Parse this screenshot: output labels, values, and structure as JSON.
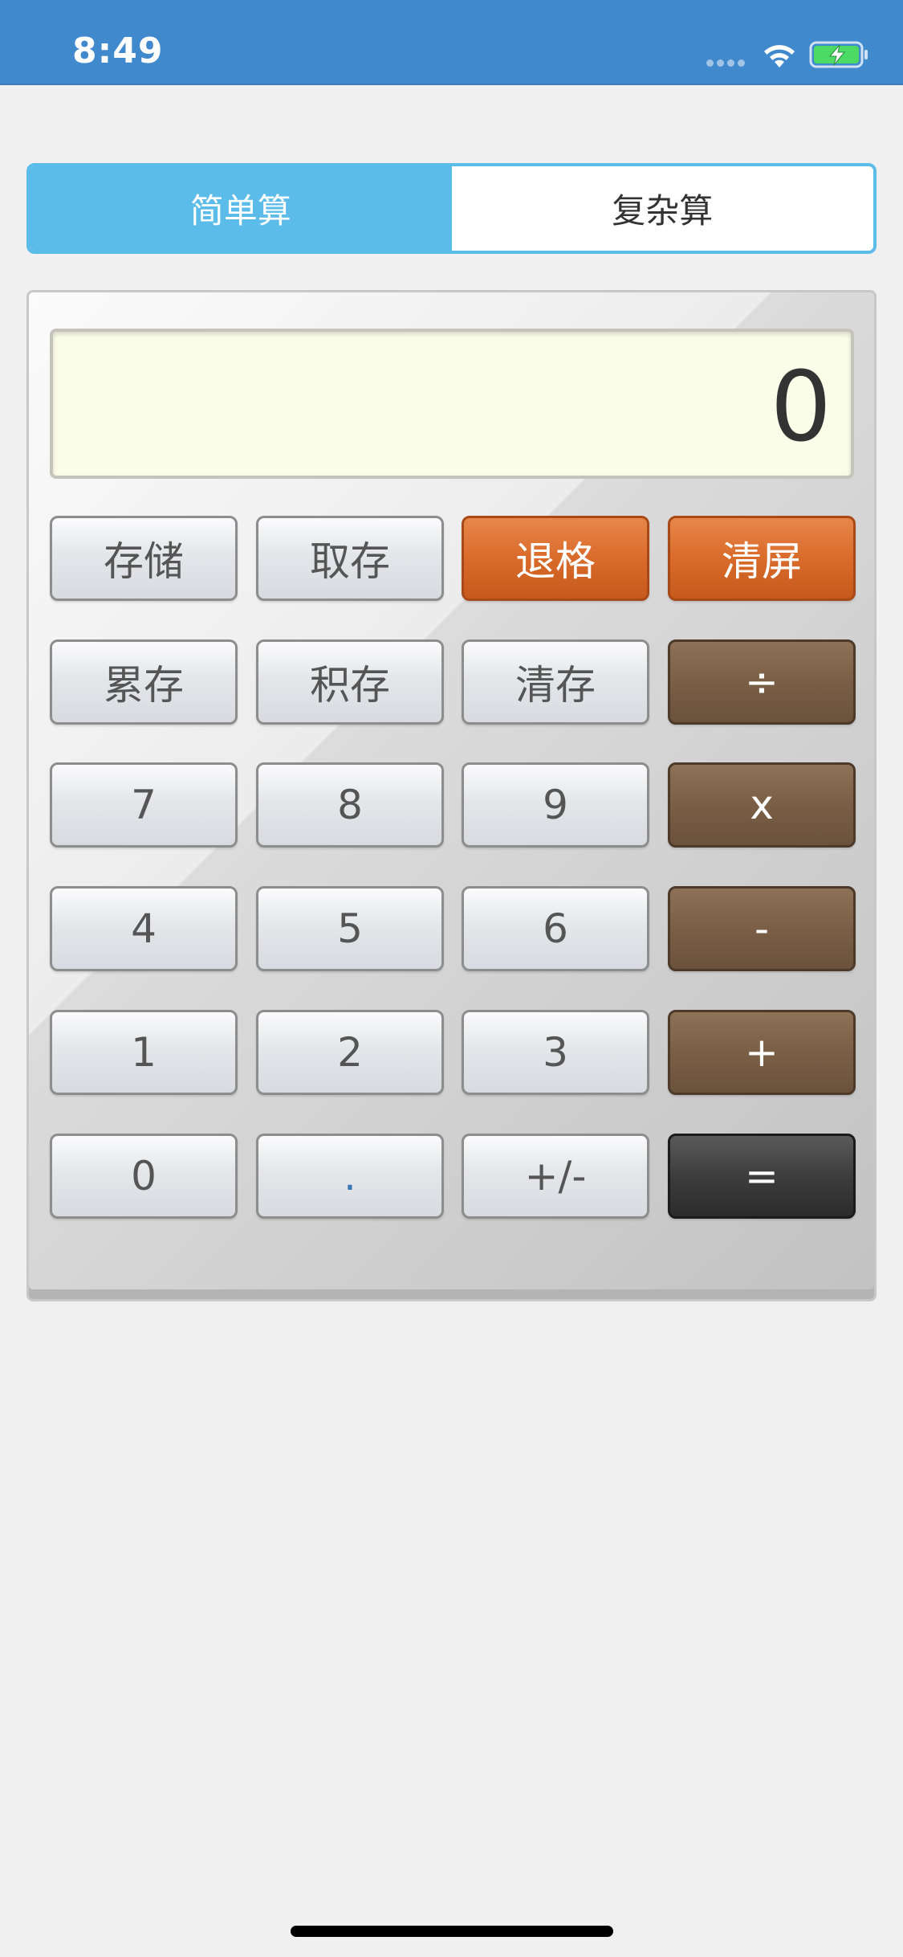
{
  "status_bar": {
    "time": "8:49",
    "icons": [
      "signal-dots-icon",
      "wifi-icon",
      "battery-charging-icon"
    ]
  },
  "tabs": [
    {
      "label": "简单算",
      "active": true
    },
    {
      "label": "复杂算",
      "active": false
    }
  ],
  "display": {
    "value": "0"
  },
  "keys": {
    "store": "存储",
    "recall": "取存",
    "backspace": "退格",
    "clear": "清屏",
    "mem_add": "累存",
    "mem_mul": "积存",
    "mem_clear": "清存",
    "divide": "÷",
    "seven": "7",
    "eight": "8",
    "nine": "9",
    "multiply": "x",
    "four": "4",
    "five": "5",
    "six": "6",
    "minus": "-",
    "one": "1",
    "two": "2",
    "three": "3",
    "plus": "+",
    "zero": "0",
    "decimal": ".",
    "negate": "+/-",
    "equals": "="
  },
  "colors": {
    "status_bar": "#4189cd",
    "tab_active": "#5bbbe9",
    "display_bg": "#fafde8",
    "orange_key": "#d96b2b",
    "brown_key": "#7a5f46",
    "dark_key": "#3d3d3d"
  }
}
